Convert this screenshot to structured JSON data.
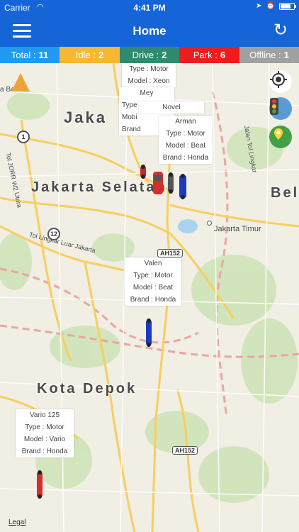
{
  "status_bar": {
    "carrier": "Carrier",
    "time": "4:41 PM"
  },
  "nav": {
    "title": "Home"
  },
  "tabs": [
    {
      "label": "Total :",
      "count": "11",
      "color": "#1e9bf0"
    },
    {
      "label": "Idle :",
      "count": "2",
      "color": "#f7b733"
    },
    {
      "label": "Drive :",
      "count": "2",
      "color": "#2e8b6f"
    },
    {
      "label": "Park :",
      "count": "6",
      "color": "#ee1c1c"
    },
    {
      "label": "Offline :",
      "count": "1",
      "color": "#a0a0a0"
    }
  ],
  "map": {
    "labels": {
      "jakarta_selatan": "Jakarta Selatan",
      "jaka": "Jaka",
      "kota_depok": "Kota Depok",
      "bel": "Bel",
      "jakarta_timur": "Jakarta Timur",
      "lingkar_luar": "Tol Lingkar Luar Jakarta",
      "jorr": "Tol JORR W2 Utara",
      "tol_lingkar": "Jalan Tol Lingkar",
      "bara": "a Bara"
    },
    "shields": {
      "route1": "1",
      "route12": "12",
      "ah152_a": "AH152",
      "ah152_b": "AH152"
    },
    "legal": "Legal"
  },
  "vehicles": [
    {
      "name": "",
      "type": "Type : Motor",
      "model": "Model : Xeon",
      "brand": ""
    },
    {
      "name": "Mey",
      "type": "Type",
      "model": "Mobi",
      "brand": "Brand"
    },
    {
      "name": "Novel",
      "type": "",
      "model": "",
      "brand": ""
    },
    {
      "name": "Arman",
      "type": "Type : Motor",
      "model": "Model : Beat",
      "brand": "Brand : Honda"
    },
    {
      "name": "Valen",
      "type": "Type : Motor",
      "model": "Model : Beat",
      "brand": "Brand : Honda"
    },
    {
      "name": "Vario 125",
      "type": "Type : Motor",
      "model": "Model : Vario",
      "brand": "Brand : Honda"
    }
  ],
  "icons": [
    "menu-icon",
    "refresh-icon",
    "locate-icon",
    "traffic-icon",
    "map-type-icon",
    "compass-icon"
  ]
}
